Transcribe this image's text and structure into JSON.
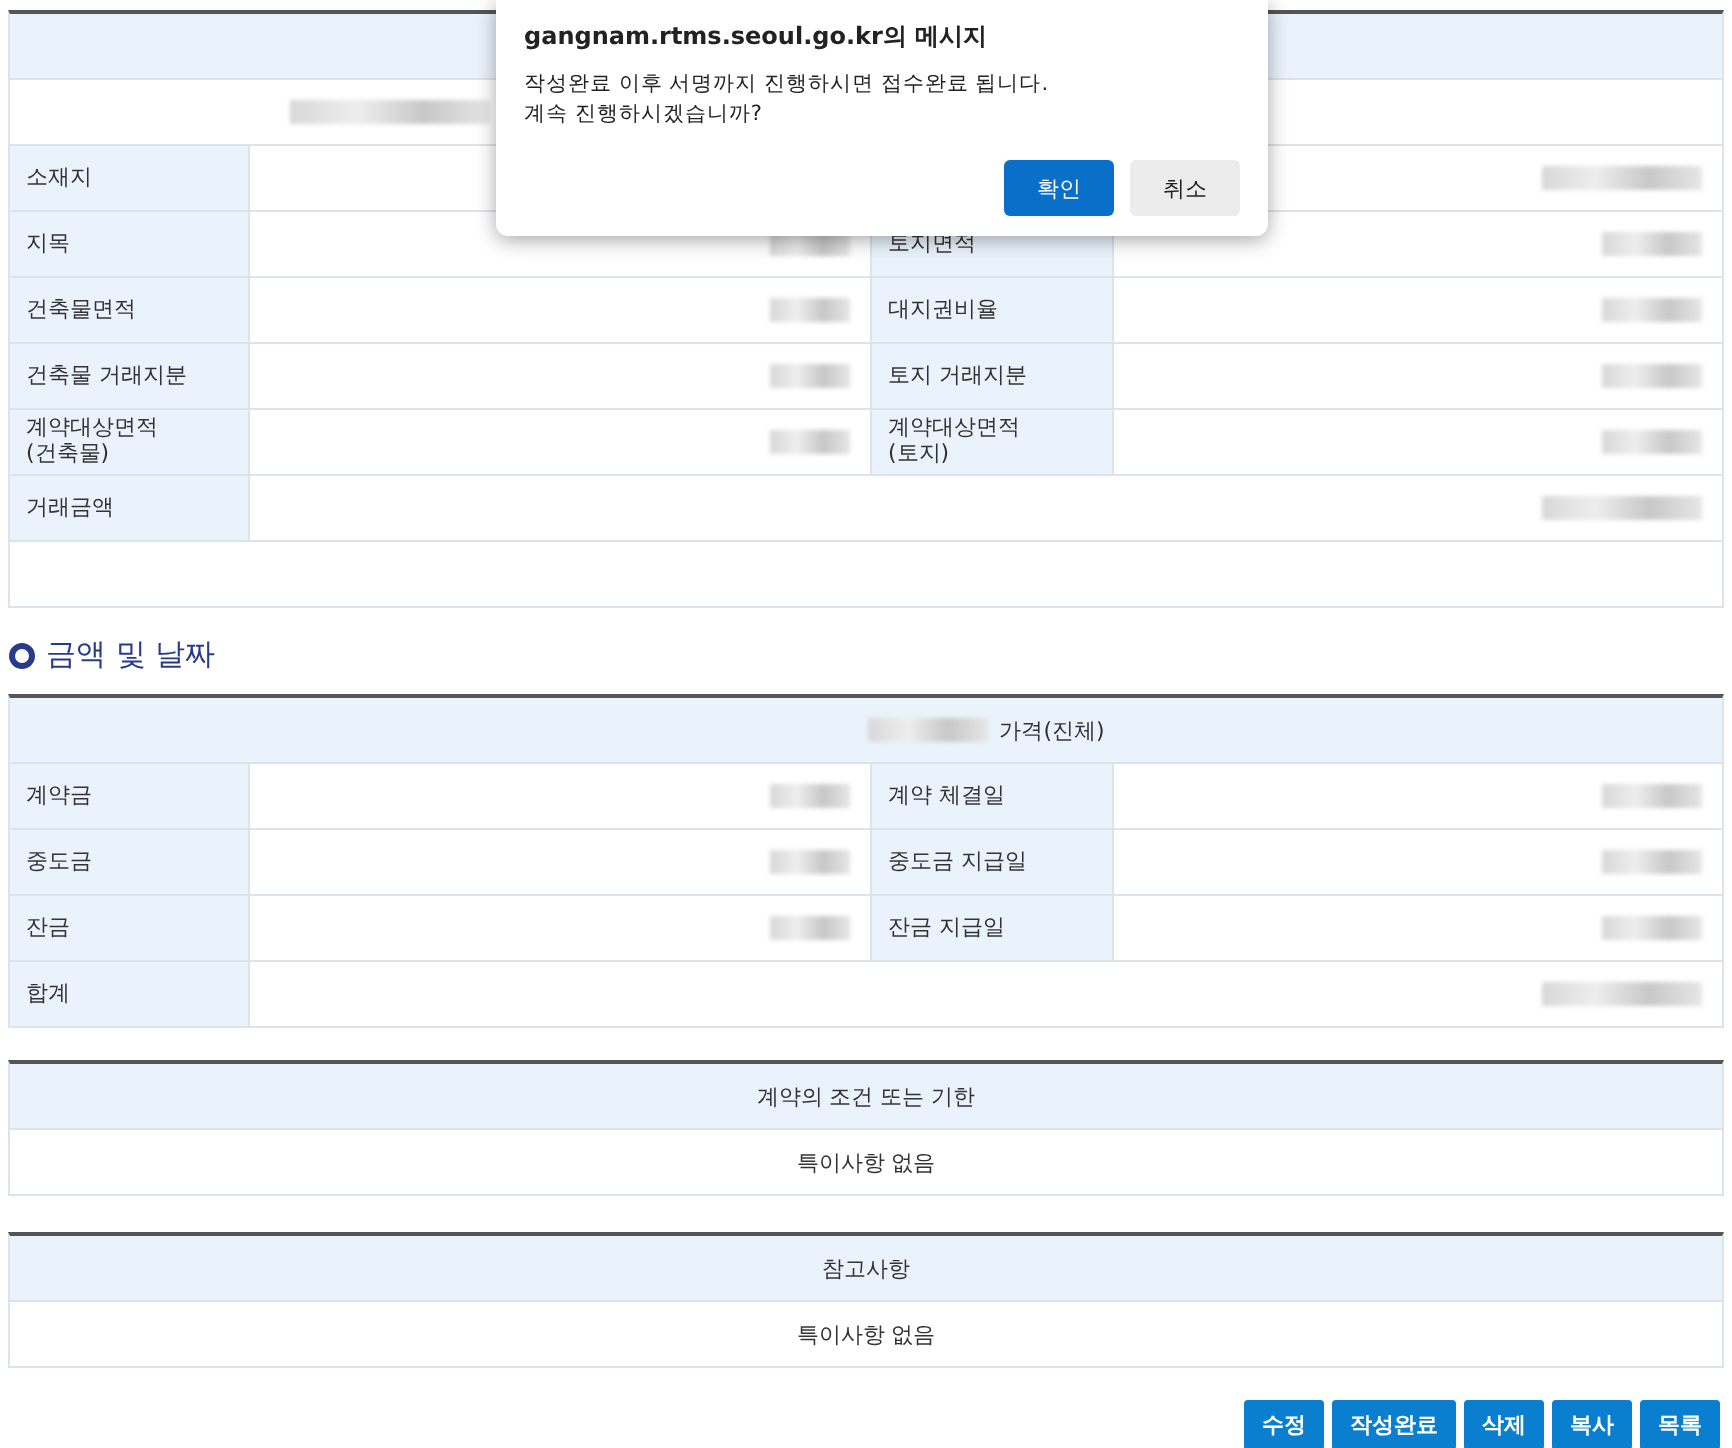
{
  "property_table": {
    "rows": [
      {
        "kind": "header"
      },
      {
        "kind": "redacted"
      },
      {
        "kind": "single",
        "label": "소재지"
      },
      {
        "kind": "pair",
        "label": "지목",
        "label2": "토지면적"
      },
      {
        "kind": "pair",
        "label": "건축물면적",
        "label2": "대지권비율"
      },
      {
        "kind": "pair",
        "label": "건축물 거래지분",
        "label2": "토지 거래지분"
      },
      {
        "kind": "pair",
        "label": "계약대상면적\n(건축물)",
        "label2": "계약대상면적\n(토지)"
      },
      {
        "kind": "single",
        "label": "거래금액"
      },
      {
        "kind": "blank"
      }
    ]
  },
  "section_title": "금액 및 날짜",
  "amount_table": {
    "header": "가격(진체)",
    "rows": [
      {
        "kind": "pair",
        "label": "계약금",
        "label2": "계약 체결일"
      },
      {
        "kind": "pair",
        "label": "중도금",
        "label2": "중도금 지급일"
      },
      {
        "kind": "pair",
        "label": "잔금",
        "label2": "잔금 지급일"
      },
      {
        "kind": "single",
        "label": "합계"
      }
    ]
  },
  "notes": [
    {
      "title": "계약의 조건 또는 기한",
      "text": "특이사항 없음"
    },
    {
      "title": "참고사항",
      "text": "특이사항 없음"
    }
  ],
  "buttons": [
    "수정",
    "작성완료",
    "삭제",
    "복사",
    "목록"
  ],
  "dialog": {
    "title": "gangnam.rtms.seoul.go.kr의 메시지",
    "message": [
      "작성완료 이후 서명까지 진행하시면 접수완료 됩니다.",
      "계속 진행하시겠습니까?"
    ],
    "buttons": [
      {
        "label": "확인",
        "primary": true
      },
      {
        "label": "취소",
        "primary": false
      }
    ]
  }
}
